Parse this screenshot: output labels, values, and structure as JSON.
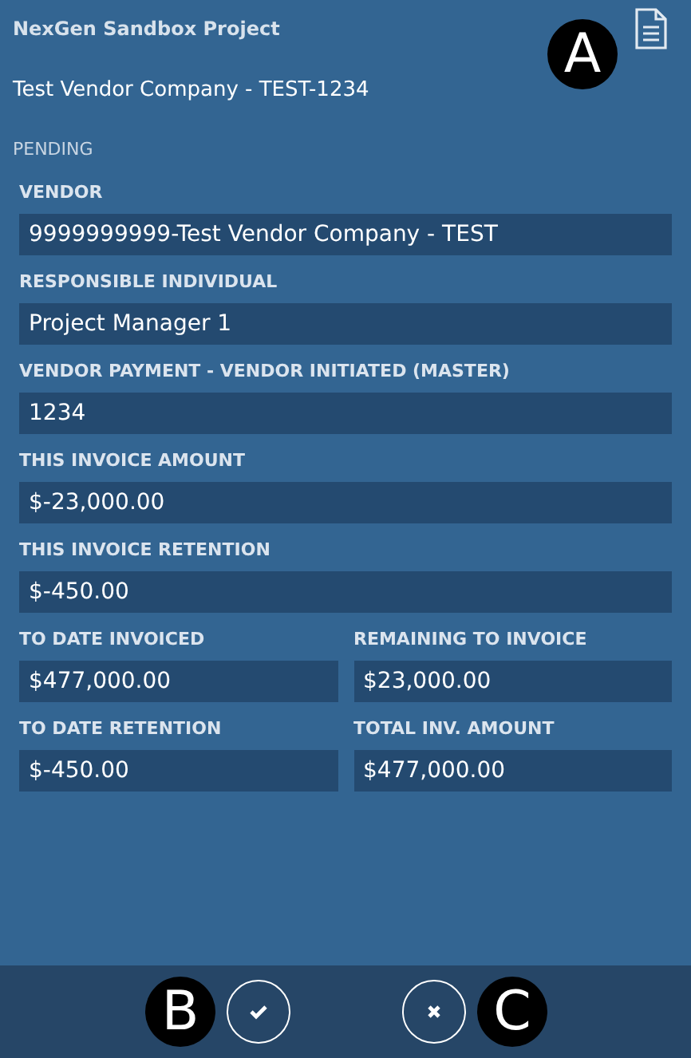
{
  "header": {
    "project": "NexGen Sandbox Project",
    "title": "Test Vendor Company - TEST-1234",
    "status": "PENDING"
  },
  "callouts": [
    {
      "label": "A"
    },
    {
      "label": "B"
    },
    {
      "label": "C"
    }
  ],
  "fields": [
    {
      "label": "VENDOR",
      "value": "9999999999-Test Vendor Company - TEST",
      "kind": "full"
    },
    {
      "label": "RESPONSIBLE INDIVIDUAL",
      "value": "Project Manager 1",
      "kind": "full"
    },
    {
      "label": "VENDOR PAYMENT - VENDOR INITIATED (MASTER)",
      "value": "1234",
      "kind": "full"
    },
    {
      "label": "THIS INVOICE AMOUNT",
      "value": "$-23,000.00",
      "kind": "full"
    },
    {
      "label": "THIS INVOICE RETENTION",
      "value": "$-450.00",
      "kind": "full"
    },
    {
      "label": "TO DATE INVOICED",
      "value": "$477,000.00",
      "kind": "half"
    },
    {
      "label": "REMAINING TO INVOICE",
      "value": "$23,000.00",
      "kind": "half"
    },
    {
      "label": "TO DATE RETENTION",
      "value": "$-450.00",
      "kind": "half"
    },
    {
      "label": "TOTAL INV. AMOUNT",
      "value": "$477,000.00",
      "kind": "half"
    }
  ]
}
